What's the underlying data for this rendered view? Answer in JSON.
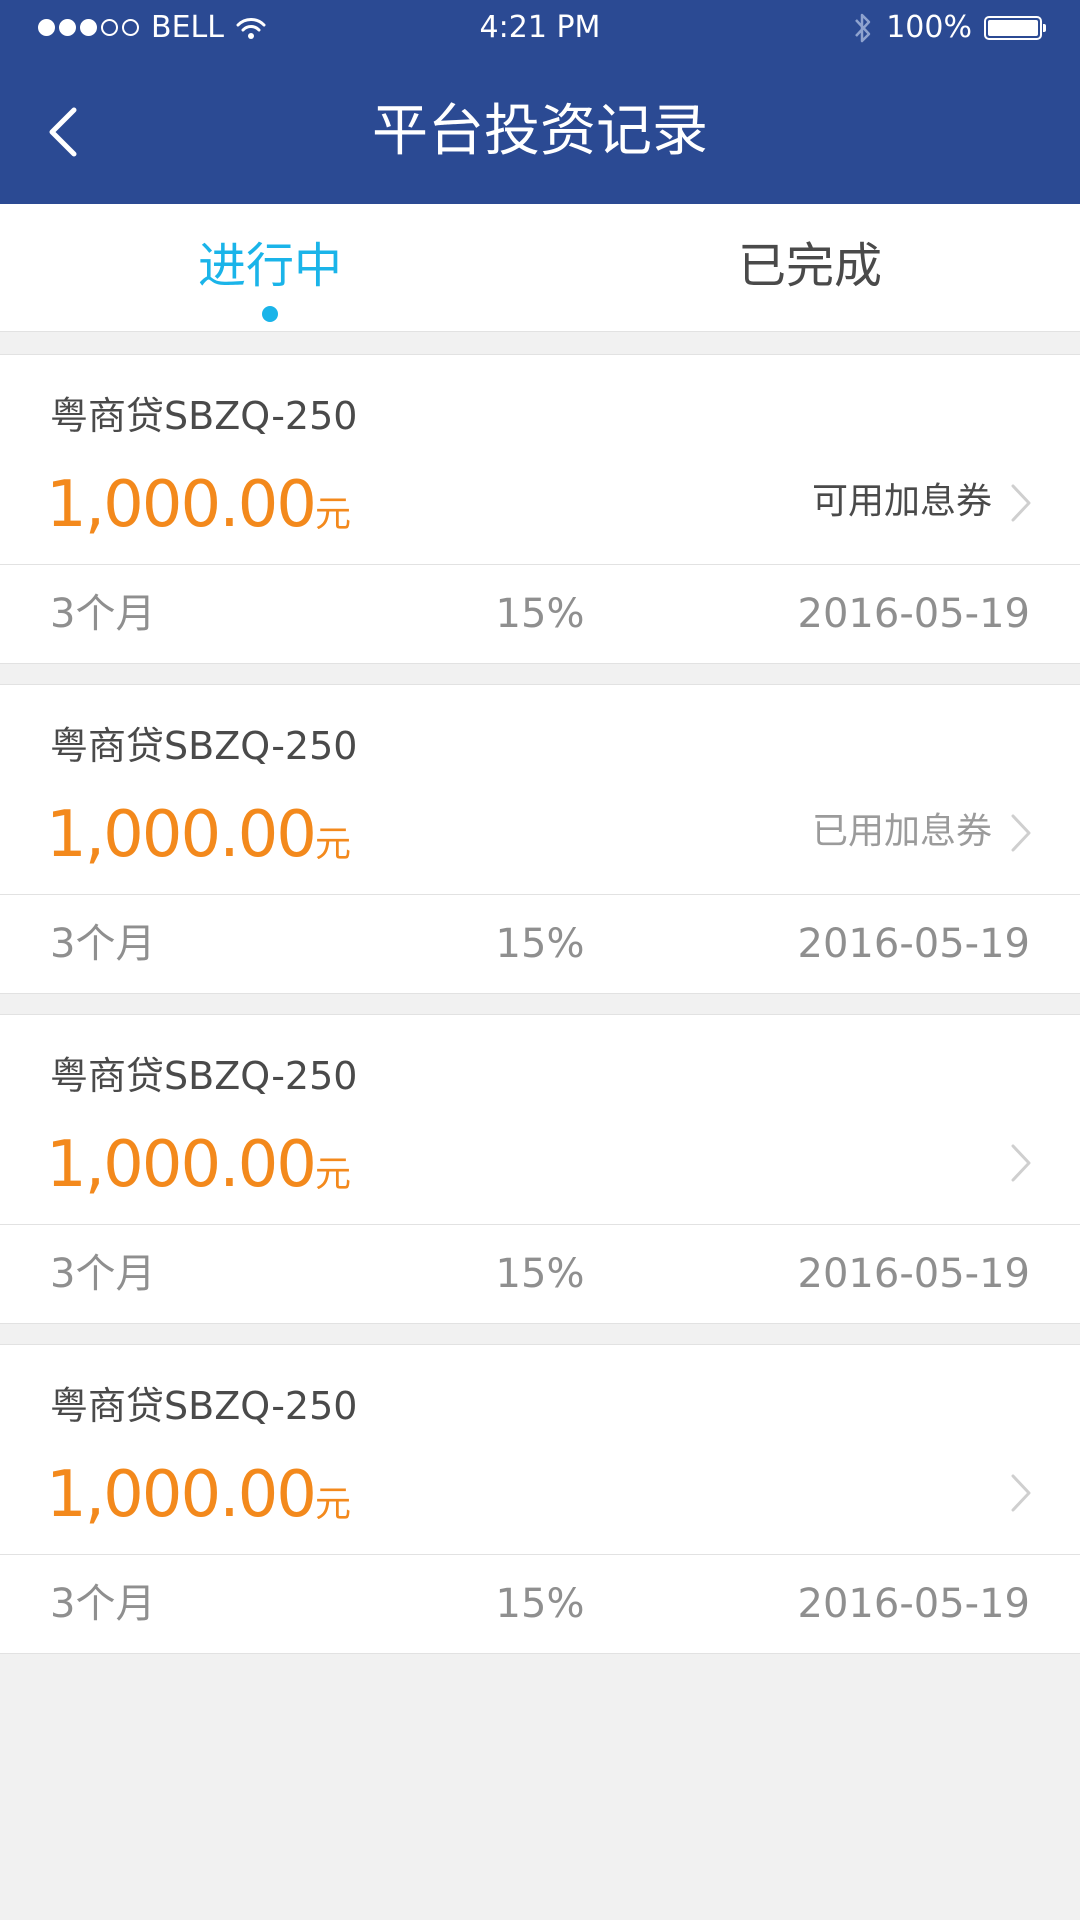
{
  "status_bar": {
    "carrier": "BELL",
    "time": "4:21 PM",
    "battery": "100%",
    "icons": [
      "signal-dots-icon",
      "wifi-icon",
      "bluetooth-icon",
      "battery-icon"
    ]
  },
  "nav": {
    "title": "平台投资记录",
    "back_icon": "chevron-left-icon"
  },
  "tabs": [
    {
      "label": "进行中",
      "active": true
    },
    {
      "label": "已完成",
      "active": false
    }
  ],
  "colors": {
    "header_bg": "#2b4a93",
    "tab_active": "#1ab4e9",
    "amount": "#f3891c",
    "coupon_available": "#4a4a4a",
    "coupon_used": "#9b9b9b"
  },
  "records": [
    {
      "name": "粤商贷SBZQ-250",
      "amount": "1,000.00",
      "unit": "元",
      "coupon": "可用加息券",
      "term": "3个月",
      "rate": "15%",
      "date": "2016-05-19"
    },
    {
      "name": "粤商贷SBZQ-250",
      "amount": "1,000.00",
      "unit": "元",
      "coupon": "已用加息券",
      "term": "3个月",
      "rate": "15%",
      "date": "2016-05-19"
    },
    {
      "name": "粤商贷SBZQ-250",
      "amount": "1,000.00",
      "unit": "元",
      "coupon": "",
      "term": "3个月",
      "rate": "15%",
      "date": "2016-05-19"
    },
    {
      "name": "粤商贷SBZQ-250",
      "amount": "1,000.00",
      "unit": "元",
      "coupon": "",
      "term": "3个月",
      "rate": "15%",
      "date": "2016-05-19"
    }
  ]
}
